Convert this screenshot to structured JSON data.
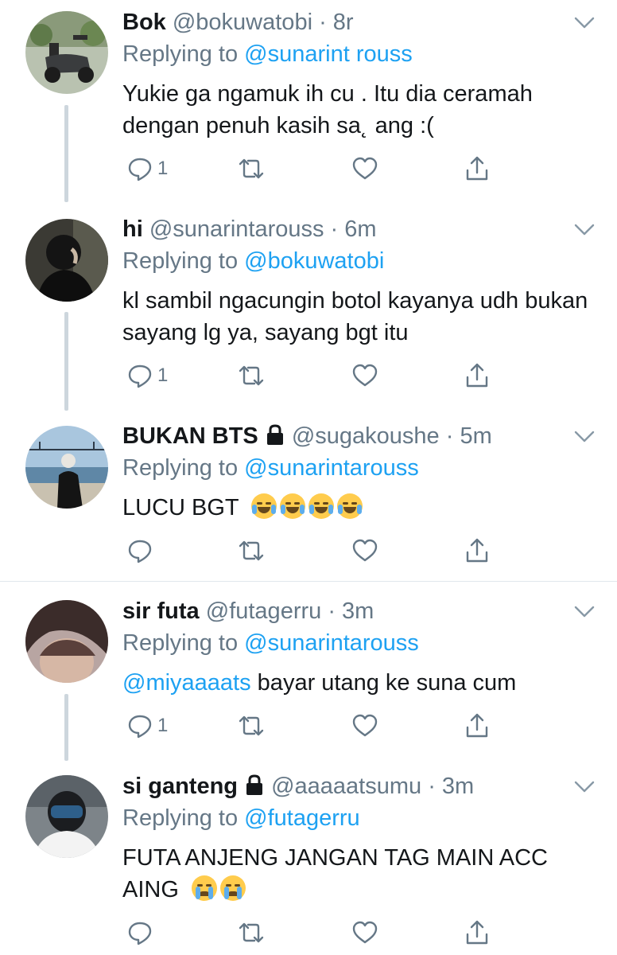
{
  "tweets": [
    {
      "name": "Bok",
      "handle": "@bokuwatobi",
      "time": "8r",
      "locked": false,
      "replying_prefix": "Replying to ",
      "replying_to": "@sunarint  rouss",
      "body_mention": "",
      "body": "Yukie ga ngamuk ih cu  . Itu dia ceramah dengan penuh kasih sa˛ ang :(",
      "emojis": [],
      "reply_count": "1"
    },
    {
      "name": "hi",
      "handle": "@sunarintarouss",
      "time": "6m",
      "locked": false,
      "replying_prefix": "Replying to ",
      "replying_to": "@bokuwatobi",
      "body_mention": "",
      "body": "kl sambil ngacungin botol kayanya udh bukan sayang lg ya, sayang bgt itu",
      "emojis": [],
      "reply_count": "1"
    },
    {
      "name": "BUKAN BTS",
      "handle": "@sugakoushe",
      "time": "5m",
      "locked": true,
      "replying_prefix": "Replying to ",
      "replying_to": "@sunarintarouss",
      "body_mention": "",
      "body": "LUCU BGT",
      "emojis": [
        "rofl-emoji",
        "rofl-emoji",
        "rofl-emoji",
        "rofl-emoji"
      ],
      "reply_count": ""
    },
    {
      "name": "sir futa",
      "handle": "@futagerru",
      "time": "3m",
      "locked": false,
      "replying_prefix": "Replying to ",
      "replying_to": "@sunarintarouss",
      "body_mention": "@miyaaaats",
      "body": " bayar utang ke suna cum",
      "emojis": [],
      "reply_count": "1"
    },
    {
      "name": "si ganteng",
      "handle": "@aaaaatsumu",
      "time": "3m",
      "locked": true,
      "replying_prefix": "Replying to ",
      "replying_to": "@futagerru",
      "body_mention": "",
      "body": "FUTA ANJENG JANGAN TAG MAIN ACC AING",
      "emojis": [
        "loudly-crying-emoji",
        "loudly-crying-emoji"
      ],
      "reply_count": ""
    }
  ],
  "separator": " · ",
  "icons": {
    "reply": "reply-icon",
    "retweet": "retweet-icon",
    "like": "heart-icon",
    "share": "share-icon",
    "more": "chevron-down-icon",
    "lock": "lock-icon"
  },
  "colors": {
    "text": "#14171a",
    "secondary": "#657786",
    "link": "#1da1f2",
    "thread_line": "#cdd6dd",
    "divider": "#e1e8ed"
  }
}
